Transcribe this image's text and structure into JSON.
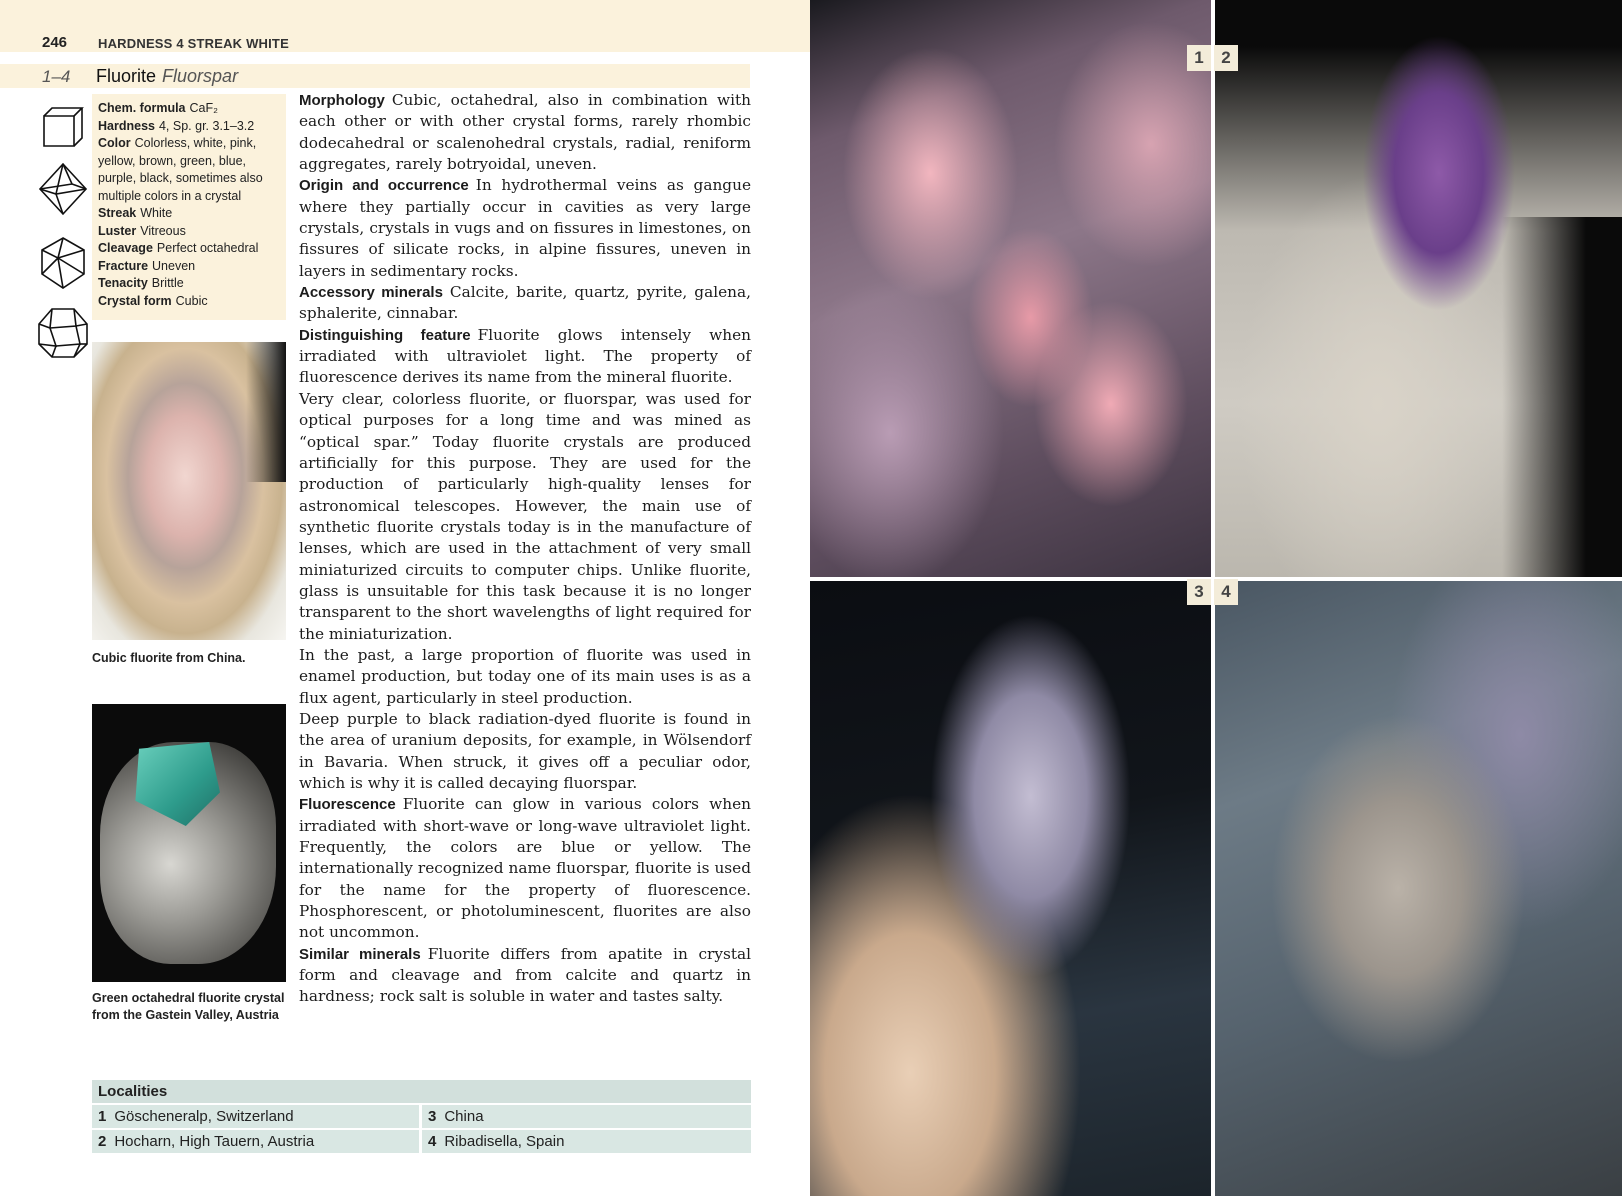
{
  "header": {
    "page_number": "246",
    "running_head": "HARDNESS 4 STREAK WHITE"
  },
  "title": {
    "range": "1–4",
    "name": "Fluorite",
    "alt_name": "Fluorspar"
  },
  "crystal_icons": [
    "cube-icon",
    "octahedron-icon",
    "rhombic-dodecahedron-icon",
    "cubo-octahedron-icon"
  ],
  "facts": [
    {
      "label": "Chem. formula",
      "value": "CaF₂"
    },
    {
      "label": "Hardness",
      "value": "4, Sp. gr. 3.1–3.2"
    },
    {
      "label": "Color",
      "value": "Colorless, white, pink, yellow, brown, green, blue, purple, black, sometimes also multiple colors in a crystal"
    },
    {
      "label": "Streak",
      "value": "White"
    },
    {
      "label": "Luster",
      "value": "Vitreous"
    },
    {
      "label": "Cleavage",
      "value": "Perfect octahedral"
    },
    {
      "label": "Fracture",
      "value": "Uneven"
    },
    {
      "label": "Tenacity",
      "value": "Brittle"
    },
    {
      "label": "Crystal form",
      "value": "Cubic"
    }
  ],
  "captions": {
    "photo1": "Cubic fluorite from China.",
    "photo2": "Green octahedral fluorite crystal from the Gastein Valley, Austria"
  },
  "body": [
    {
      "lead": "Morphology",
      "text": "Cubic, octahedral, also in combination with each other or with other crystal forms, rarely rhombic dodecahedral or scalenohedral crystals, radial, reniform aggregates, rarely botryoidal, uneven."
    },
    {
      "lead": "Origin and occurrence",
      "text": "In hydrothermal veins as gangue where they partially occur in cavities as very large crystals, crystals in vugs and on fissures in limestones, on fissures of silicate rocks, in alpine fissures, uneven in layers in sedimentary rocks."
    },
    {
      "lead": "Accessory minerals",
      "text": "Calcite, barite, quartz, pyrite, galena, sphalerite, cinnabar."
    },
    {
      "lead": "Distinguishing feature",
      "text": "Fluorite glows intensely when irradiated with ultraviolet light. The property of fluorescence derives its name from the mineral fluorite."
    },
    {
      "lead": "",
      "text": "Very clear, colorless fluorite, or fluorspar, was used for optical purposes for a long time and was mined as “optical spar.” Today fluorite crystals are produced artificially for this purpose. They are used for the production of particularly high-quality lenses for astronomical telescopes. However, the main use of synthetic fluorite crystals today is in the manufacture of lenses, which are used in the attachment of very small miniaturized circuits to computer chips. Unlike fluorite, glass is unsuitable for this task because it is no longer transparent to the short wavelengths of light required for the miniaturization."
    },
    {
      "lead": "",
      "text": "In the past, a large proportion of fluorite was used in enamel production, but today one of its main uses is as a flux agent, particularly in steel production."
    },
    {
      "lead": "",
      "text": "Deep purple to black radiation-dyed fluorite is found in the area of uranium deposits, for example, in Wölsendorf in Bavaria. When struck, it gives off a peculiar odor, which is why it is called decaying fluorspar."
    },
    {
      "lead": "Fluorescence",
      "text": "Fluorite can glow in various colors when irradiated with short-wave or long-wave ultraviolet light. Frequently, the colors are blue or yellow. The internationally recognized name fluorspar, fluorite is used for the name for the property of fluorescence. Phosphorescent, or photoluminescent, fluorites are also not uncommon."
    },
    {
      "lead": "Similar minerals",
      "text": "Fluorite differs from apatite in crystal form and cleavage and from calcite and quartz in hardness; rock salt is soluble in water and tastes salty."
    }
  ],
  "localities": {
    "heading": "Localities",
    "items": [
      {
        "num": "1",
        "place": "Göscheneralp, Switzerland"
      },
      {
        "num": "3",
        "place": "China"
      },
      {
        "num": "2",
        "place": "Hocharn, High Tauern, Austria"
      },
      {
        "num": "4",
        "place": "Ribadisella, Spain"
      }
    ]
  },
  "photo_tags": [
    "1",
    "2",
    "3",
    "4"
  ]
}
